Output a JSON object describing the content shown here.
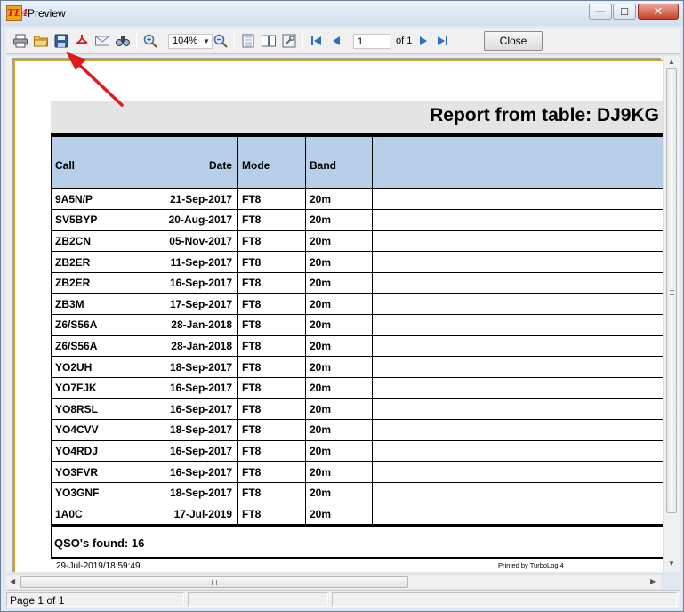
{
  "window": {
    "title": "Preview",
    "app_icon_text": "TL4",
    "minimize": "—",
    "maximize": "☐",
    "close": "✕"
  },
  "toolbar": {
    "zoom": "104%",
    "page_input": "1",
    "page_of": "of 1",
    "close_label": "Close",
    "icons": [
      "print-icon",
      "open-folder-icon",
      "save-icon",
      "pdf-icon",
      "email-icon",
      "find-icon",
      "zoom-in-icon",
      "zoom-out-icon",
      "page-setup-icon",
      "two-pages-icon",
      "settings-icon",
      "first-page-icon",
      "prev-page-icon",
      "next-page-icon",
      "last-page-icon"
    ]
  },
  "report": {
    "title": "Report from table: DJ9KG",
    "columns": [
      "Call",
      "Date",
      "Mode",
      "Band"
    ],
    "rows": [
      [
        "9A5N/P",
        "21-Sep-2017",
        "FT8",
        "20m"
      ],
      [
        "SV5BYP",
        "20-Aug-2017",
        "FT8",
        "20m"
      ],
      [
        "ZB2CN",
        "05-Nov-2017",
        "FT8",
        "20m"
      ],
      [
        "ZB2ER",
        "11-Sep-2017",
        "FT8",
        "20m"
      ],
      [
        "ZB2ER",
        "16-Sep-2017",
        "FT8",
        "20m"
      ],
      [
        "ZB3M",
        "17-Sep-2017",
        "FT8",
        "20m"
      ],
      [
        "Z6/S56A",
        "28-Jan-2018",
        "FT8",
        "20m"
      ],
      [
        "Z6/S56A",
        "28-Jan-2018",
        "FT8",
        "20m"
      ],
      [
        "YO2UH",
        "18-Sep-2017",
        "FT8",
        "20m"
      ],
      [
        "YO7FJK",
        "16-Sep-2017",
        "FT8",
        "20m"
      ],
      [
        "YO8RSL",
        "16-Sep-2017",
        "FT8",
        "20m"
      ],
      [
        "YO4CVV",
        "18-Sep-2017",
        "FT8",
        "20m"
      ],
      [
        "YO4RDJ",
        "16-Sep-2017",
        "FT8",
        "20m"
      ],
      [
        "YO3FVR",
        "16-Sep-2017",
        "FT8",
        "20m"
      ],
      [
        "YO3GNF",
        "18-Sep-2017",
        "FT8",
        "20m"
      ],
      [
        "1A0C",
        "17-Jul-2019",
        "FT8",
        "20m"
      ]
    ],
    "found": "QSO's found: 16",
    "footer_date": "29-Jul-2019/18:59:49",
    "footer_printed": "Printed by TurboLog 4"
  },
  "status": {
    "page": "Page 1 of 1"
  },
  "colors": {
    "header_fill": "#b8cfe9",
    "title_band": "#e4e4e4",
    "page_border": "#d6a62b",
    "annotation_arrow": "#e01b1b"
  }
}
